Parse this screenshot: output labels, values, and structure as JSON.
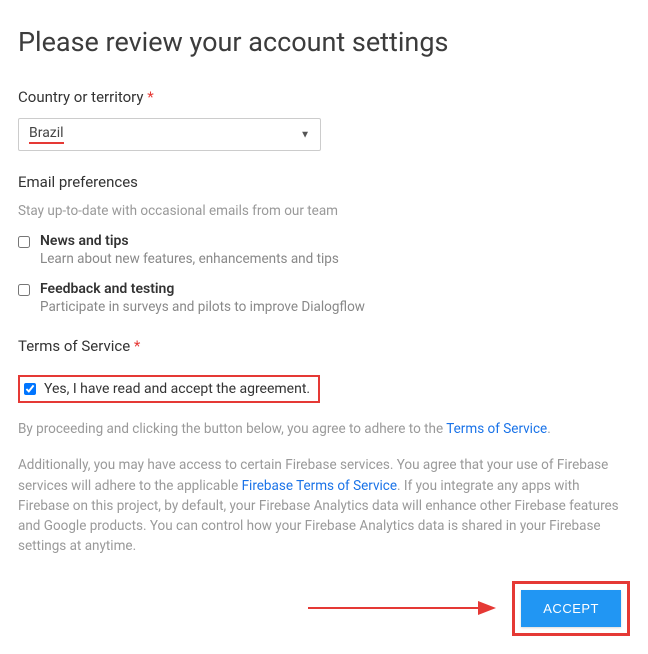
{
  "title": "Please review your account settings",
  "country": {
    "label": "Country or territory",
    "value": "Brazil"
  },
  "email": {
    "label": "Email preferences",
    "subtext": "Stay up-to-date with occasional emails from our team",
    "items": [
      {
        "title": "News and tips",
        "desc": "Learn about new features, enhancements and tips"
      },
      {
        "title": "Feedback and testing",
        "desc": "Participate in surveys and pilots to improve Dialogflow"
      }
    ]
  },
  "tos": {
    "label": "Terms of Service",
    "accept_label": "Yes, I have read and accept the agreement.",
    "p1_a": "By proceeding and clicking the button below, you agree to adhere to the ",
    "p1_link": "Terms of Service",
    "p1_b": ".",
    "p2_a": "Additionally, you may have access to certain Firebase services. You agree that your use of Firebase services will adhere to the applicable ",
    "p2_link": "Firebase Terms of Service",
    "p2_b": ". If you integrate any apps with Firebase on this project, by default, your Firebase Analytics data will enhance other Firebase features and Google products. You can control how your Firebase Analytics data is shared in your Firebase settings at anytime."
  },
  "accept_button": "ACCEPT"
}
